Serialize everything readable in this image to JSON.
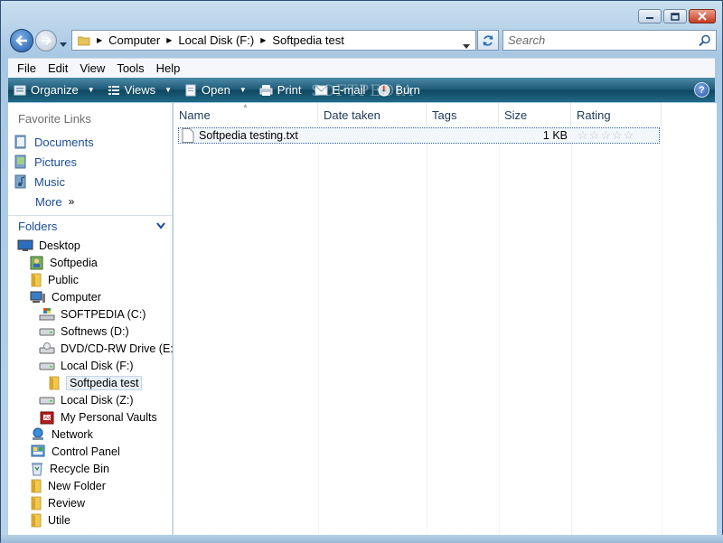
{
  "window": {
    "caption_buttons": [
      "minimize",
      "maximize",
      "close"
    ]
  },
  "address": {
    "crumbs": [
      "Computer",
      "Local Disk (F:)",
      "Softpedia test"
    ]
  },
  "search": {
    "placeholder": "Search"
  },
  "menu": [
    "File",
    "Edit",
    "View",
    "Tools",
    "Help"
  ],
  "commands": {
    "organize": "Organize",
    "views": "Views",
    "open": "Open",
    "print": "Print",
    "email": "E-mail",
    "burn": "Burn",
    "help": "?"
  },
  "watermark": "SOFTPEDIA",
  "favorite_links": {
    "header": "Favorite Links",
    "items": [
      "Documents",
      "Pictures",
      "Music"
    ],
    "more": "More"
  },
  "folders": {
    "header": "Folders",
    "tree": [
      {
        "label": "Desktop",
        "icon": "desktop-icon",
        "level": 0
      },
      {
        "label": "Softpedia",
        "icon": "user-folder-icon",
        "level": 1
      },
      {
        "label": "Public",
        "icon": "folder-icon",
        "level": 1
      },
      {
        "label": "Computer",
        "icon": "computer-icon",
        "level": 1
      },
      {
        "label": "SOFTPEDIA (C:)",
        "icon": "windows-drive-icon",
        "level": 2
      },
      {
        "label": "Softnews (D:)",
        "icon": "drive-icon",
        "level": 2
      },
      {
        "label": "DVD/CD-RW Drive (E:)",
        "icon": "dvd-drive-icon",
        "level": 2
      },
      {
        "label": "Local Disk (F:)",
        "icon": "drive-icon",
        "level": 2
      },
      {
        "label": "Softpedia test",
        "icon": "folder-icon",
        "level": 3,
        "selected": true
      },
      {
        "label": "Local Disk (Z:)",
        "icon": "drive-icon",
        "level": 2
      },
      {
        "label": "My Personal Vaults",
        "icon": "vault-icon",
        "level": 2
      },
      {
        "label": "Network",
        "icon": "network-icon",
        "level": 1
      },
      {
        "label": "Control Panel",
        "icon": "control-panel-icon",
        "level": 1
      },
      {
        "label": "Recycle Bin",
        "icon": "recycle-bin-icon",
        "level": 1
      },
      {
        "label": "New Folder",
        "icon": "folder-icon",
        "level": 1
      },
      {
        "label": "Review",
        "icon": "folder-icon",
        "level": 1
      },
      {
        "label": "Utile",
        "icon": "folder-icon",
        "level": 1
      }
    ]
  },
  "columns": [
    "Name",
    "Date taken",
    "Tags",
    "Size",
    "Rating"
  ],
  "files": [
    {
      "name": "Softpedia testing.txt",
      "size": "1 KB",
      "rating": 0
    }
  ]
}
